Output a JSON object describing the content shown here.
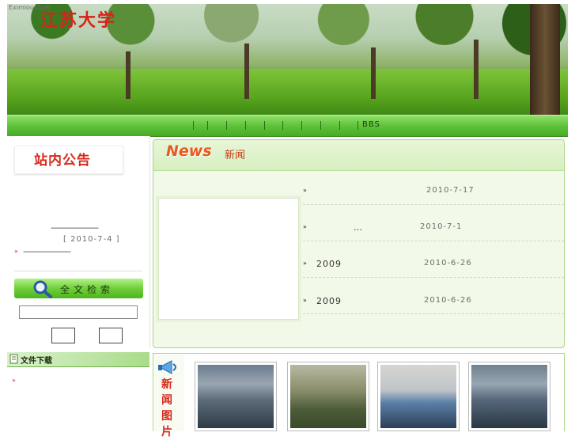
{
  "banner": {
    "caption": "EximiousSoft",
    "university_name": "江苏大学"
  },
  "nav": {
    "bbs_label": "BBS"
  },
  "notice": {
    "title": "站内公告",
    "line1": "——————",
    "date": "[ 2010-7-4 ]",
    "line2": "——————",
    "bullet": "»"
  },
  "search": {
    "title": "全文检索",
    "input_value": "",
    "button1": "  ",
    "button2": "  "
  },
  "download": {
    "title": "文件下载",
    "bullet": "»"
  },
  "news": {
    "heading_en": "News",
    "heading_cn": "新闻",
    "items": [
      {
        "bullet": "»",
        "text": "",
        "date": "2010-7-17"
      },
      {
        "bullet": "»",
        "text": "…",
        "date": "2010-7-1"
      },
      {
        "bullet": "»",
        "text": "2009",
        "date": "2010-6-26"
      },
      {
        "bullet": "»",
        "text": "2009",
        "date": "2010-6-26"
      }
    ]
  },
  "photos": {
    "label": "新闻图片"
  },
  "colors": {
    "accent_green": "#5fc23a",
    "title_red": "#d52a1c",
    "news_orange": "#e85a1e"
  }
}
